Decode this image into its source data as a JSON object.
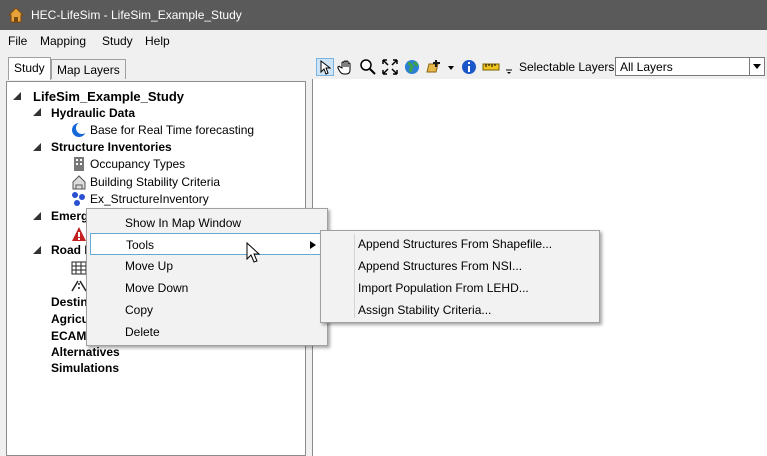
{
  "window": {
    "title": "HEC-LifeSim - LifeSim_Example_Study"
  },
  "menu": [
    "File",
    "Mapping",
    "Study",
    "Help"
  ],
  "tabs": [
    "Study",
    "Map Layers"
  ],
  "toolbar": {
    "selectable_label": "Selectable Layers:",
    "selectable_value": "All Layers",
    "icons": [
      "select-arrow-icon",
      "pan-hand-icon",
      "zoom-icon",
      "full-extent-icon",
      "globe-icon",
      "add-layer-icon",
      "dropdown-arrow-icon",
      "info-icon",
      "measure-ruler-icon",
      "overflow-icon"
    ]
  },
  "tree": {
    "root": "LifeSim_Example_Study",
    "hydraulic": "Hydraulic Data",
    "hydraulic_child": "Base for Real Time forecasting",
    "structure": "Structure Inventories",
    "occupancy": "Occupancy Types",
    "stability": "Building Stability Criteria",
    "inventory": "Ex_StructureInventory",
    "emergency": "Emerg",
    "road": "Road N",
    "destinations": "Destin",
    "agriculture": "Agricu",
    "ecam": "ECAM",
    "alternatives": "Alternatives",
    "simulations": "Simulations"
  },
  "context_menu": {
    "items": [
      "Show In Map Window",
      "Tools",
      "Move Up",
      "Move Down",
      "Copy",
      "Delete"
    ]
  },
  "submenu": {
    "items": [
      "Append Structures From Shapefile...",
      "Append Structures From NSI...",
      "Import Population From LEHD...",
      "Assign Stability Criteria..."
    ]
  }
}
